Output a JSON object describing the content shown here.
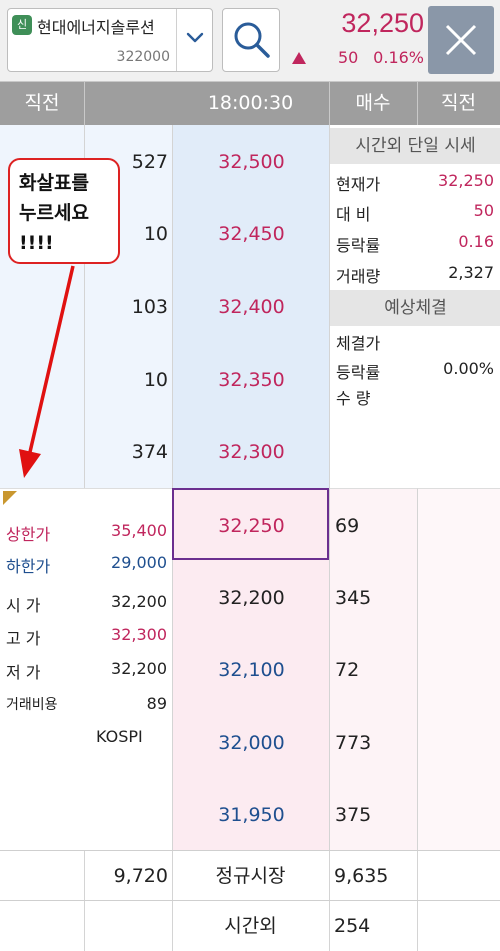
{
  "stock": {
    "badge": "신",
    "name": "현대에너지솔루션",
    "code": "322000",
    "current_price": "32,250",
    "change": "50",
    "change_rate": "0.16%"
  },
  "header": {
    "prev_left": "직전",
    "time": "18:00:30",
    "bid_label": "매수",
    "prev_right": "직전"
  },
  "asks": [
    {
      "qty": "527",
      "price": "32,500"
    },
    {
      "qty": "10",
      "price": "32,450"
    },
    {
      "qty": "103",
      "price": "32,400"
    },
    {
      "qty": "10",
      "price": "32,350"
    },
    {
      "qty": "374",
      "price": "32,300"
    }
  ],
  "bids": [
    {
      "price": "32,250",
      "qty": "69"
    },
    {
      "price": "32,200",
      "qty": "345"
    },
    {
      "price": "32,100",
      "qty": "72"
    },
    {
      "price": "32,000",
      "qty": "773"
    },
    {
      "price": "31,950",
      "qty": "375"
    }
  ],
  "info": {
    "upper_limit_label": "상한가",
    "upper_limit": "35,400",
    "lower_limit_label": "하한가",
    "lower_limit": "29,000",
    "open_label": "시 가",
    "open": "32,200",
    "high_label": "고 가",
    "high": "32,300",
    "low_label": "저 가",
    "low": "32,200",
    "volume_ratio_label": "거래비용",
    "volume_ratio": "89",
    "market": "KOSPI"
  },
  "after_hours": {
    "title": "시간외 단일 시세",
    "current_label": "현재가",
    "current": "32,250",
    "change_label": "대 비",
    "change": "50",
    "rate_label": "등락률",
    "rate": "0.16",
    "volume_label": "거래량",
    "volume": "2,327",
    "expected_title": "예상체결",
    "exp_price_label": "체결가",
    "exp_rate_label": "등락률",
    "exp_rate": "0.00%",
    "exp_qty_label": "수 량"
  },
  "totals": {
    "ask_total": "9,720",
    "regular_label": "정규시장",
    "bid_total": "9,635",
    "after_label": "시간외",
    "after_bid": "254"
  },
  "annotation": {
    "text": "화살표를\n누르세요\n!!!!"
  },
  "colors": {
    "up": "#c0265d",
    "down": "#1f4f8f",
    "neutral": "#222222",
    "annotation": "#dd1111"
  }
}
